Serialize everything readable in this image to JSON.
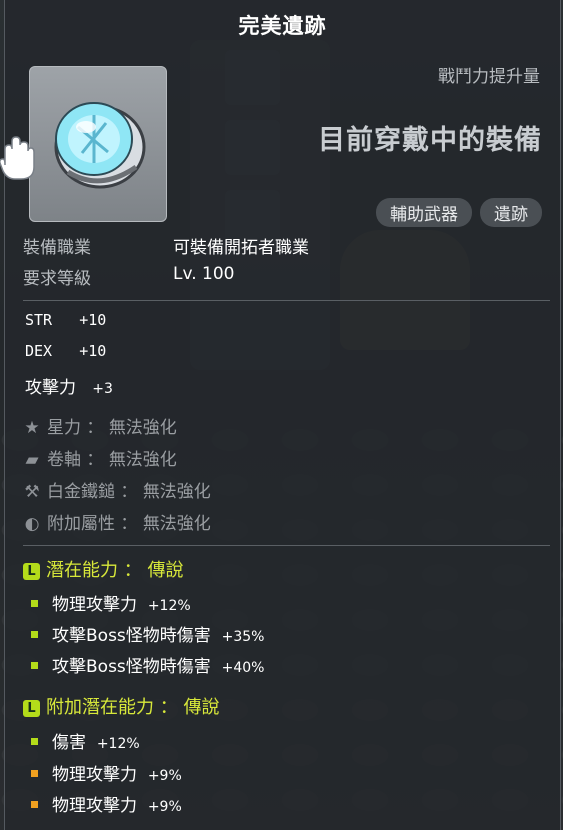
{
  "item": {
    "name": "完美遺跡",
    "combat_power_label": "戰鬥力提升量",
    "equipped_text": "目前穿戴中的裝備",
    "tags": [
      "輔助武器",
      "遺跡"
    ]
  },
  "requirements": {
    "job_label": "裝備職業",
    "job_value": "可裝備開拓者職業",
    "level_label": "要求等級",
    "level_value": "Lv. 100"
  },
  "stats": [
    {
      "name": "STR",
      "value": "+10"
    },
    {
      "name": "DEX",
      "value": "+10"
    },
    {
      "name": "攻擊力",
      "value": "+3"
    }
  ],
  "enhancements": [
    {
      "icon": "star-icon",
      "label": "星力",
      "value": "無法強化"
    },
    {
      "icon": "scroll-icon",
      "label": "卷軸",
      "value": "無法強化"
    },
    {
      "icon": "hammer-icon",
      "label": "白金鐵鎚",
      "value": "無法強化"
    },
    {
      "icon": "bonus-stat-icon",
      "label": "附加屬性",
      "value": "無法強化"
    }
  ],
  "potential": {
    "badge": "L",
    "title": "潛在能力 ： 傳說",
    "color": "#d8e83a",
    "lines": [
      {
        "text": "物理攻擊力",
        "value": "+12%"
      },
      {
        "text": "攻擊Boss怪物時傷害",
        "value": "+35%"
      },
      {
        "text": "攻擊Boss怪物時傷害",
        "value": "+40%"
      }
    ]
  },
  "additional_potential": {
    "badge": "L",
    "title": "附加潛在能力 ： 傳說",
    "color": "#d8e83a",
    "lines": [
      {
        "text": "傷害",
        "value": "+12%",
        "tier_color": "#b4dc1a"
      },
      {
        "text": "物理攻擊力",
        "value": "+9%",
        "tier_color": "#f0a020"
      },
      {
        "text": "物理攻擊力",
        "value": "+9%",
        "tier_color": "#f0a020"
      }
    ]
  }
}
